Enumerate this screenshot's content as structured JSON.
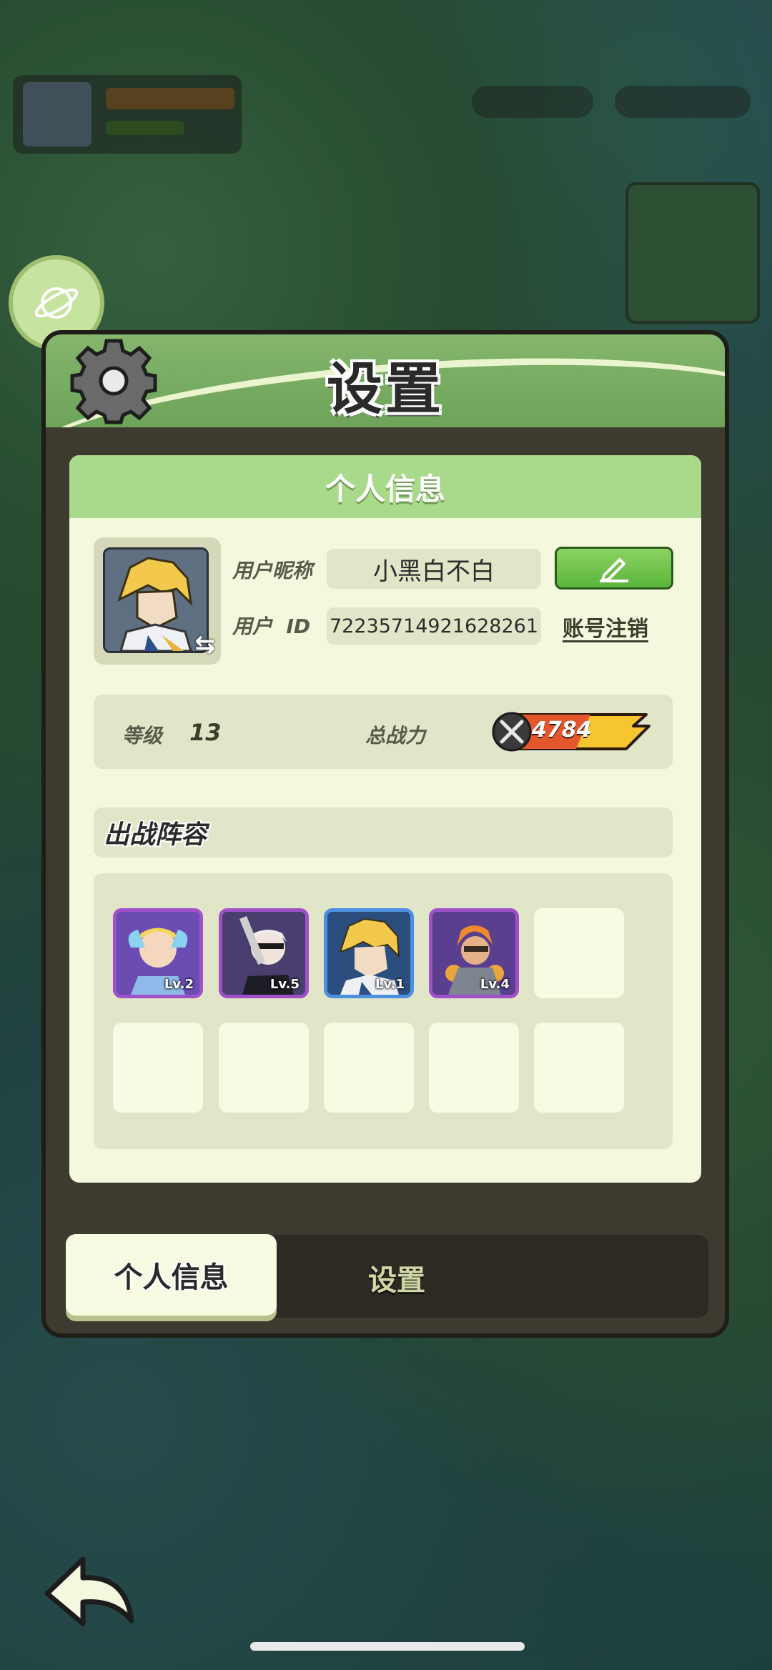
{
  "header": {
    "title": "设置",
    "icon": "gear-icon"
  },
  "profile": {
    "section_title": "个人信息",
    "nickname_label": "用户昵称",
    "nickname_value": "小黑白不白",
    "id_label": "用户  ID",
    "id_value": "72235714921628261",
    "cancel_account_link": "账号注销",
    "edit_icon": "pencil-icon",
    "swap_icon": "swap-icon"
  },
  "stats": {
    "level_label": "等级",
    "level_value": "13",
    "power_label": "总战力",
    "power_value": "4784",
    "power_icon": "crossed-swords-icon"
  },
  "lineup": {
    "title": "出战阵容",
    "heroes": [
      {
        "level": "Lv.2",
        "frame": "purple"
      },
      {
        "level": "Lv.5",
        "frame": "purple"
      },
      {
        "level": "Lv.1",
        "frame": "blue"
      },
      {
        "level": "Lv.4",
        "frame": "purple"
      }
    ],
    "empty_slots": 6
  },
  "tabs": [
    {
      "label": "个人信息",
      "active": true
    },
    {
      "label": "设置",
      "active": false
    }
  ],
  "colors": {
    "header_green": "#84b66c",
    "card_bg": "#f4f9dd",
    "card_head": "#a9d98a",
    "edit_green": "#5ab53a",
    "hero_purple_frame": "#a050c8",
    "hero_blue_frame": "#4d8fe0"
  }
}
